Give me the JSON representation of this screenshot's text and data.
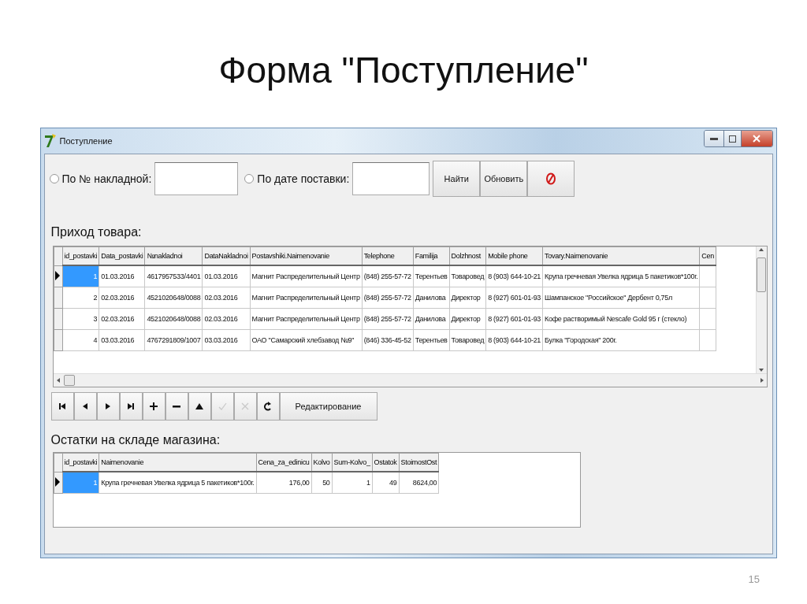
{
  "slide": {
    "title": "Форма \"Поступление\"",
    "page_number": "15"
  },
  "window": {
    "title": "Поступление"
  },
  "search": {
    "options": [
      {
        "label": "По № накладной:",
        "selected": false
      },
      {
        "label": "По дате поставки:",
        "selected": false
      }
    ],
    "buttons": [
      {
        "kind": "text",
        "label": "Найти"
      },
      {
        "kind": "text",
        "label": "Обновить"
      },
      {
        "kind": "cancel"
      }
    ]
  },
  "receipts": {
    "heading": "Приход товара:",
    "columns": [
      "id_postavki",
      "Data_postavki",
      "№nakladnoi",
      "DataNakladnoi",
      "Postavshiki.Naimenovanie",
      "Telephone",
      "Familija",
      "Dolzhnost",
      "Mobile phone",
      "Tovary.Naimenovanie",
      "Cen"
    ],
    "rows": [
      {
        "selected": true,
        "cells": [
          "1",
          "01.03.2016",
          "4617957533/4401",
          "01.03.2016",
          "Магнит Распределительный Центр",
          "(848) 255-57-72",
          "Терентьев",
          "Товаровед",
          "8 (903) 644-10-21",
          "Крупа гречневая Увелка ядрица 5 пакетиков*100г.",
          ""
        ]
      },
      {
        "selected": false,
        "cells": [
          "2",
          "02.03.2016",
          "4521020648/0088",
          "02.03.2016",
          "Магнит Распределительный Центр",
          "(848) 255-57-72",
          "Данилова",
          "Директор",
          "8 (927) 601-01-93",
          "Шампанское \"Российское\" Дербент 0,75л",
          ""
        ]
      },
      {
        "selected": false,
        "cells": [
          "3",
          "02.03.2016",
          "4521020648/0088",
          "02.03.2016",
          "Магнит Распределительный Центр",
          "(848) 255-57-72",
          "Данилова",
          "Директор",
          "8 (927) 601-01-93",
          "Кофе растворимый Nescafe Gold 95 г (стекло)",
          ""
        ]
      },
      {
        "selected": false,
        "cells": [
          "4",
          "03.03.2016",
          "4767291809/1007",
          "03.03.2016",
          "ОАО \"Самарский хлебзавод №9\"",
          "(846) 336-45-52",
          "Терентьев",
          "Товаровед",
          "8 (903) 644-10-21",
          "Булка \"Городская\" 200г.",
          ""
        ]
      }
    ]
  },
  "navigator": {
    "buttons": [
      {
        "kind": "first",
        "disabled": false
      },
      {
        "kind": "prior",
        "disabled": false
      },
      {
        "kind": "next",
        "disabled": false
      },
      {
        "kind": "last",
        "disabled": false
      },
      {
        "kind": "insert",
        "disabled": false
      },
      {
        "kind": "delete",
        "disabled": false
      },
      {
        "kind": "edit",
        "disabled": false
      },
      {
        "kind": "post",
        "disabled": true
      },
      {
        "kind": "cancel",
        "disabled": true
      },
      {
        "kind": "refresh",
        "disabled": false
      }
    ],
    "edit_button": "Редактирование"
  },
  "stock": {
    "heading": "Остатки на складе магазина:",
    "columns": [
      "id_postavki",
      "Naimenovanie",
      "Cena_za_edinicu",
      "Kolvo",
      "Sum-Kolvo_",
      "Ostatok",
      "StoimostOst"
    ],
    "rows": [
      {
        "selected": true,
        "cells": [
          "1",
          "Крупа гречневая Увелка ядрица 5 пакетиков*100г.",
          "176,00",
          "50",
          "1",
          "49",
          "8624,00"
        ]
      }
    ]
  }
}
